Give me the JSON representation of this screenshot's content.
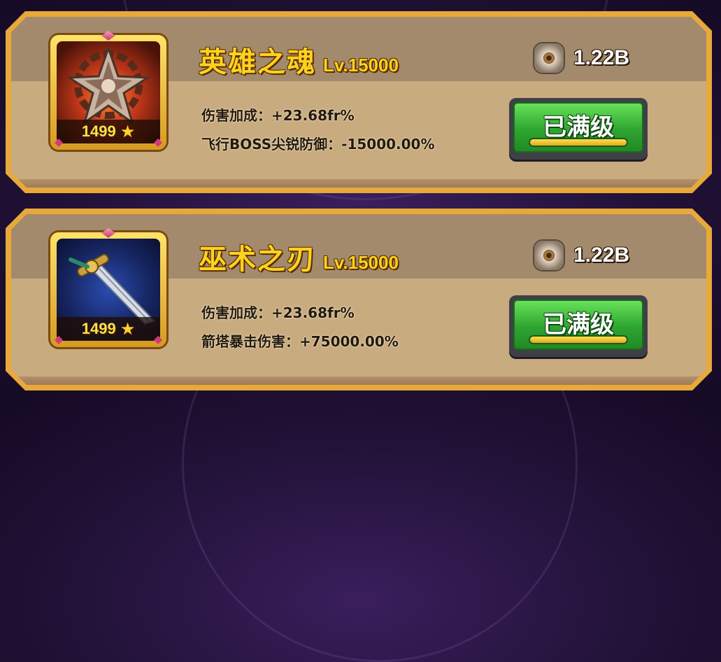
{
  "cards": [
    {
      "name": "英雄之魂",
      "level": "Lv.15000",
      "stars": "1499",
      "icon": "hero-soul-icon",
      "stats": [
        "伤害加成：+23.68fr%",
        "飞行BOSS尖锐防御：-15000.00%"
      ],
      "cost": "1.22B",
      "button": "已满级"
    },
    {
      "name": "巫术之刃",
      "level": "Lv.15000",
      "stars": "1499",
      "icon": "sorcery-blade-icon",
      "stats": [
        "伤害加成：+23.68fr%",
        "箭塔暴击伤害：+75000.00%"
      ],
      "cost": "1.22B",
      "button": "已满级"
    }
  ],
  "colors": {
    "name_gold": "#ffd21e",
    "card_border": "#e8a93a",
    "card_body": "#c9ab80",
    "button_green": "#2fa530",
    "background": "#221238"
  }
}
